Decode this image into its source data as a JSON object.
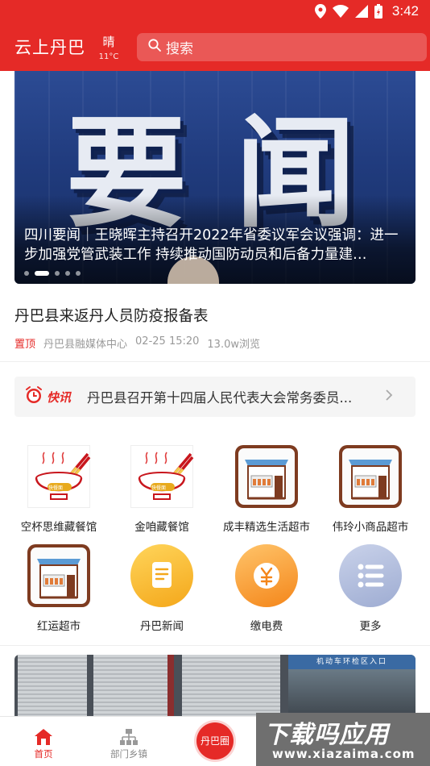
{
  "status_bar": {
    "time": "3:42"
  },
  "header": {
    "app_title": "云上丹巴",
    "weather": {
      "condition": "晴",
      "temperature": "11°C"
    },
    "search_placeholder": "搜索"
  },
  "banner": {
    "image_text": "要闻",
    "caption": "四川要闻｜王晓晖主持召开2022年省委议军会议强调：进一步加强党管武装工作 持续推动国防动员和后备力量建…",
    "slide_count": 5,
    "active_slide": 2
  },
  "top_article": {
    "title": "丹巴县来返丹人员防疫报备表",
    "pinned_label": "置顶",
    "source": "丹巴县融媒体中心",
    "date": "02-25 15:20",
    "views": "13.0w浏览"
  },
  "flash_news": {
    "label": "快讯",
    "text": "丹巴县召开第十四届人民代表大会常务委员..."
  },
  "grid": [
    {
      "label": "空杯思维藏餐馆",
      "icon": "rice-bowl-icon"
    },
    {
      "label": "金咱藏餐馆",
      "icon": "rice-bowl-icon"
    },
    {
      "label": "成丰精选生活超市",
      "icon": "storefront-icon"
    },
    {
      "label": "伟玲小商品超市",
      "icon": "storefront-icon"
    },
    {
      "label": "红运超市",
      "icon": "storefront-icon"
    },
    {
      "label": "丹巴新闻",
      "icon": "news-doc-icon"
    },
    {
      "label": "缴电费",
      "icon": "yuan-coin-icon"
    },
    {
      "label": "更多",
      "icon": "more-list-icon"
    }
  ],
  "bowl_tag": "快餐面",
  "bottom_photo": {
    "sign_text": "机动车环检区入口"
  },
  "bottom_nav": [
    {
      "label": "首页",
      "icon": "home-icon",
      "active": true
    },
    {
      "label": "部门乡镇",
      "icon": "org-chart-icon",
      "active": false
    },
    {
      "label": "丹巴圈",
      "icon": "center-circle",
      "active": false
    }
  ],
  "watermark": {
    "line1": "下载吗应用",
    "line2": "www.xiazaima.com"
  },
  "colors": {
    "brand_red": "#e52a27",
    "muted_text": "#999999"
  }
}
